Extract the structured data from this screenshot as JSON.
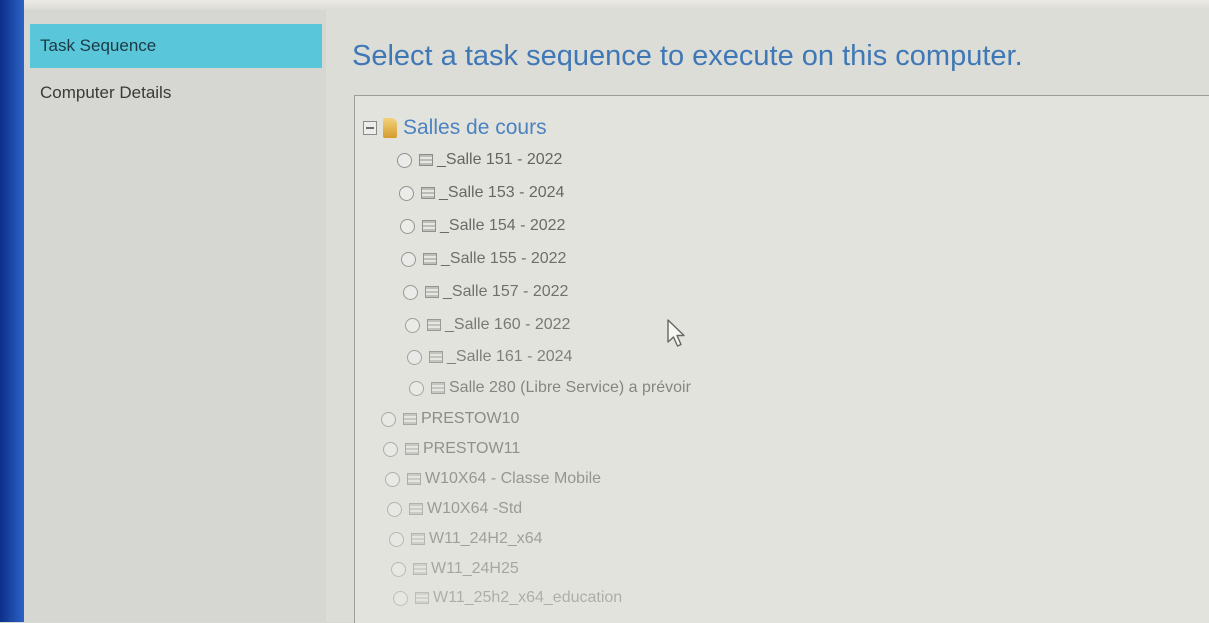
{
  "nav": {
    "items": [
      {
        "label": "Task Sequence",
        "active": true
      },
      {
        "label": "Computer Details",
        "active": false
      }
    ]
  },
  "main": {
    "title": "Select a task sequence to execute on this computer."
  },
  "tree": {
    "group": {
      "label": "Salles de cours",
      "icon": "folder-icon"
    },
    "group_items": [
      {
        "label": "_Salle 151 - 2022"
      },
      {
        "label": "_Salle 153 - 2024"
      },
      {
        "label": "_Salle 154 - 2022"
      },
      {
        "label": "_Salle 155 - 2022"
      },
      {
        "label": "_Salle 157 - 2022"
      },
      {
        "label": "_Salle 160 - 2022"
      },
      {
        "label": "_Salle 161 - 2024"
      },
      {
        "label": "Salle 280 (Libre Service) a prévoir"
      }
    ],
    "items": [
      {
        "label": "PRESTOW10"
      },
      {
        "label": "PRESTOW11"
      },
      {
        "label": "W10X64 - Classe Mobile"
      },
      {
        "label": "W10X64 -Std"
      },
      {
        "label": "W11_24H2_x64"
      },
      {
        "label": "W11_24H25"
      },
      {
        "label": "W11_25h2_x64_education"
      }
    ]
  },
  "colors": {
    "accent": "#59c6da",
    "title": "#3f78b6",
    "background": "#d9d8d2"
  }
}
